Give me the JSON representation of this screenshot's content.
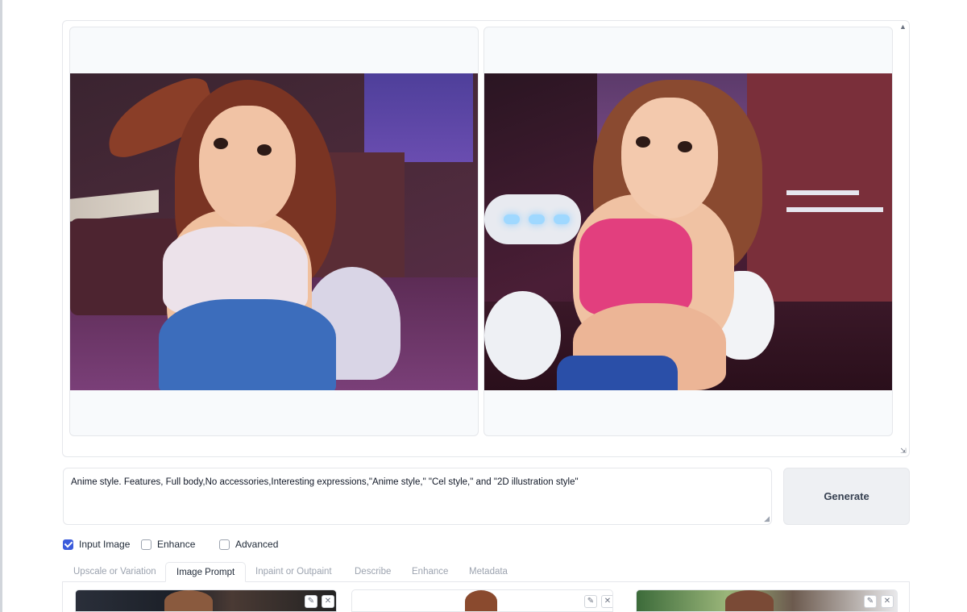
{
  "prompt": {
    "text": "Anime style. Features, Full body,No accessories,Interesting expressions,\"Anime style,\" \"Cel style,\" and \"2D illustration style\""
  },
  "generate": {
    "label": "Generate"
  },
  "options": [
    {
      "label": "Input Image",
      "checked": true
    },
    {
      "label": "Enhance",
      "checked": false
    },
    {
      "label": "Advanced",
      "checked": false
    }
  ],
  "tabs": [
    {
      "label": "Upscale or Variation",
      "active": false
    },
    {
      "label": "Image Prompt",
      "active": true
    },
    {
      "label": "Inpaint or Outpaint",
      "active": false
    },
    {
      "label": "Describe",
      "active": false
    },
    {
      "label": "Enhance",
      "active": false
    },
    {
      "label": "Metadata",
      "active": false
    }
  ],
  "icons": {
    "scroll_up": "triangle-up-icon",
    "resize": "resize-handle-icon",
    "edit": "pencil-icon",
    "remove": "close-icon"
  },
  "colors": {
    "accent": "#3b5bdb",
    "border": "#e5e7eb"
  }
}
